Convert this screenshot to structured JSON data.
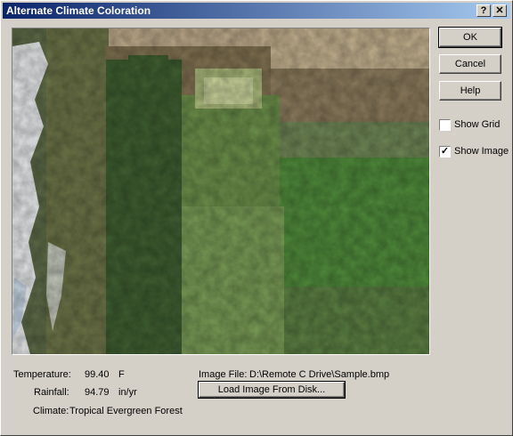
{
  "window": {
    "title": "Alternate Climate Coloration",
    "help_btn": "?",
    "close_btn": "✕"
  },
  "buttons": {
    "ok": "OK",
    "cancel": "Cancel",
    "help": "Help",
    "load_image": "Load Image From Disk..."
  },
  "checkboxes": {
    "show_grid": {
      "label": "Show Grid",
      "checked": false
    },
    "show_image": {
      "label": "Show Image",
      "checked": true,
      "mark": "✓"
    }
  },
  "climate": {
    "temperature_label": "Temperature:",
    "temperature_value": "99.40",
    "temperature_unit": "F",
    "rainfall_label": "Rainfall:",
    "rainfall_value": "94.79",
    "rainfall_unit": "in/yr",
    "climate_label": "Climate:",
    "climate_value": "Tropical Evergreen Forest"
  },
  "image_file": {
    "label": "Image File:",
    "path": "D:\\Remote C Drive\\Sample.bmp"
  },
  "colors": {
    "title_start": "#0a246a",
    "title_end": "#a6caf0",
    "face": "#d4d0c8"
  }
}
